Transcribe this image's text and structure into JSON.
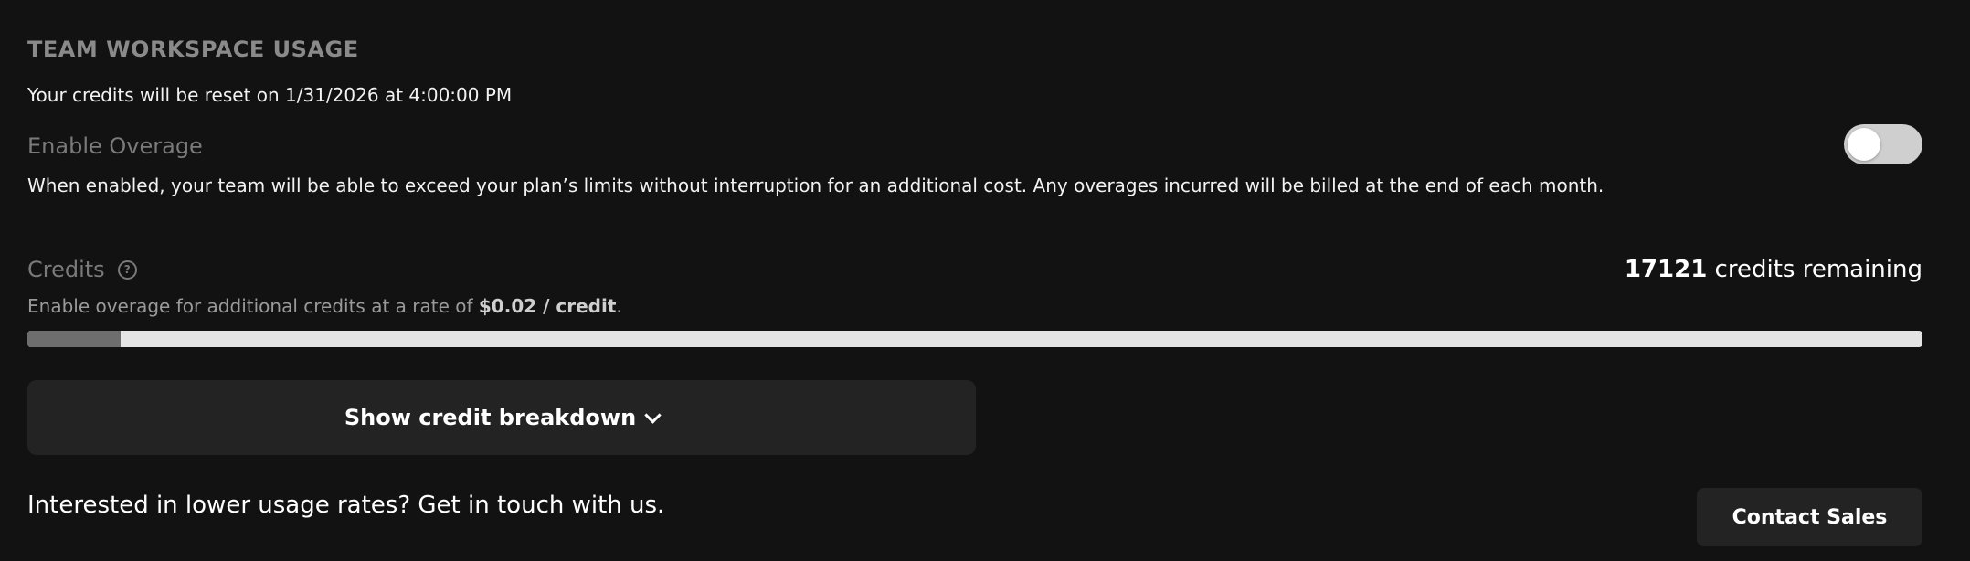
{
  "usage": {
    "title": "TEAM WORKSPACE USAGE",
    "reset_text": "Your credits will be reset on 1/31/2026 at 4:00:00 PM"
  },
  "overage": {
    "label": "Enable Overage",
    "description": "When enabled, your team will be able to exceed your plan’s limits without interruption for an additional cost. Any overages incurred will be billed at the end of each month.",
    "enabled": false
  },
  "credits": {
    "label": "Credits",
    "help_icon": "question-circle-icon",
    "remaining_number": "17121",
    "remaining_suffix": " credits remaining",
    "rate_prefix": "Enable overage for additional credits at a rate of ",
    "rate_value": "$0.02 / credit",
    "rate_suffix": ".",
    "used_fraction": 0.049
  },
  "breakdown": {
    "label": "Show credit breakdown",
    "icon": "chevron-down-icon"
  },
  "footer": {
    "lower_rates_text": "Interested in lower usage rates? Get in touch with us.",
    "contact_label": "Contact Sales"
  },
  "colors": {
    "background": "#121212",
    "button_bg": "#232323",
    "progress_track": "#e4e4e4",
    "progress_fill": "#6e6e6e"
  }
}
